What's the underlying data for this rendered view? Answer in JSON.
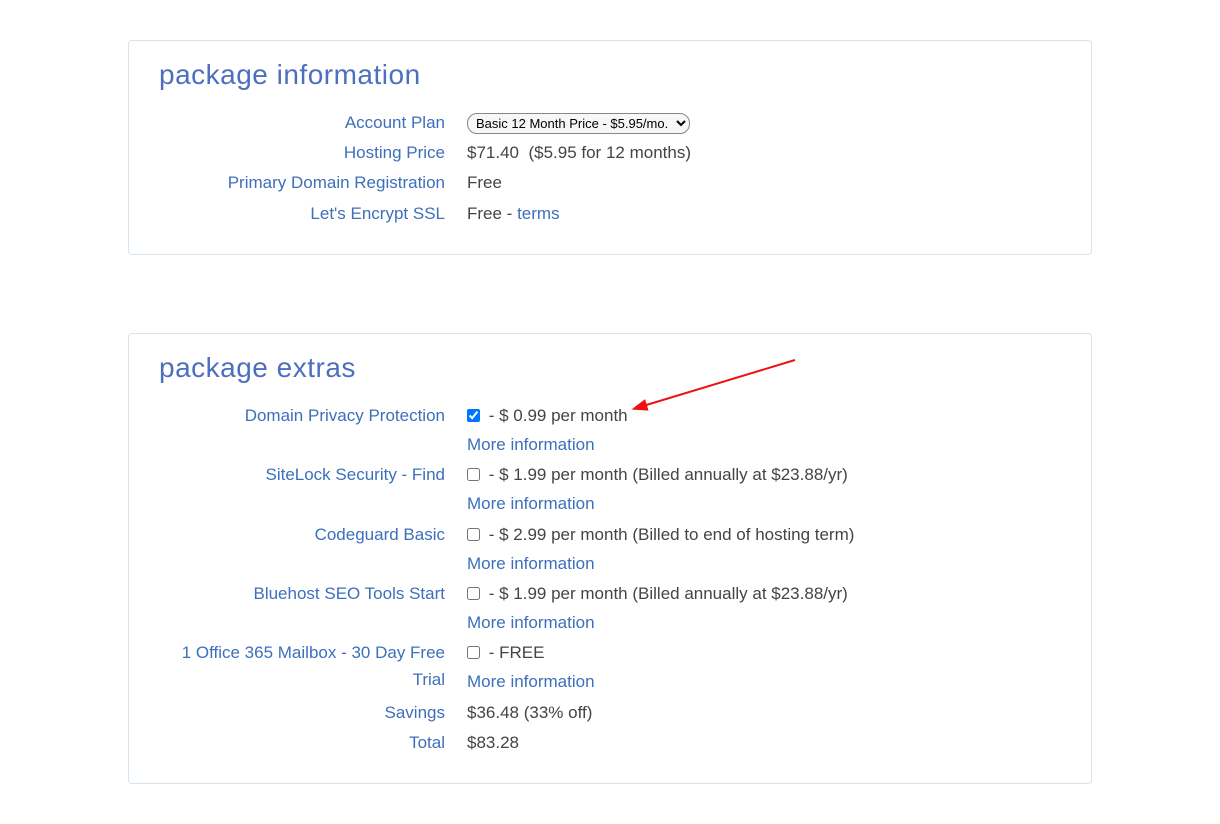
{
  "packageInfo": {
    "title": "package information",
    "rows": {
      "accountPlanLabel": "Account Plan",
      "accountPlanValue": "Basic 12 Month Price - $5.95/mo.",
      "hostingPriceLabel": "Hosting Price",
      "hostingPriceValue": "$71.40",
      "hostingPriceNote": "($5.95 for 12 months)",
      "domainRegLabel": "Primary Domain Registration",
      "domainRegValue": "Free",
      "sslLabel": "Let's Encrypt SSL",
      "sslValue": "Free - ",
      "sslTerms": "terms"
    }
  },
  "packageExtras": {
    "title": "package extras",
    "moreInfo": "More information",
    "items": {
      "privacy": {
        "label": "Domain Privacy Protection",
        "checked": true,
        "price": " - $ 0.99 per month"
      },
      "sitelock": {
        "label": "SiteLock Security - Find",
        "checked": false,
        "price": " - $ 1.99 per month (Billed annually at $23.88/yr)"
      },
      "codeguard": {
        "label": "Codeguard Basic",
        "checked": false,
        "price": " - $ 2.99 per month (Billed to end of hosting term)"
      },
      "seo": {
        "label": "Bluehost SEO Tools Start",
        "checked": false,
        "price": " - $ 1.99 per month (Billed annually at $23.88/yr)"
      },
      "o365": {
        "label": "1 Office 365 Mailbox - 30 Day Free Trial",
        "checked": false,
        "price": " - FREE"
      }
    },
    "savingsLabel": "Savings",
    "savingsValue": "$36.48 (33% off)",
    "totalLabel": "Total",
    "totalValue": "$83.28"
  }
}
